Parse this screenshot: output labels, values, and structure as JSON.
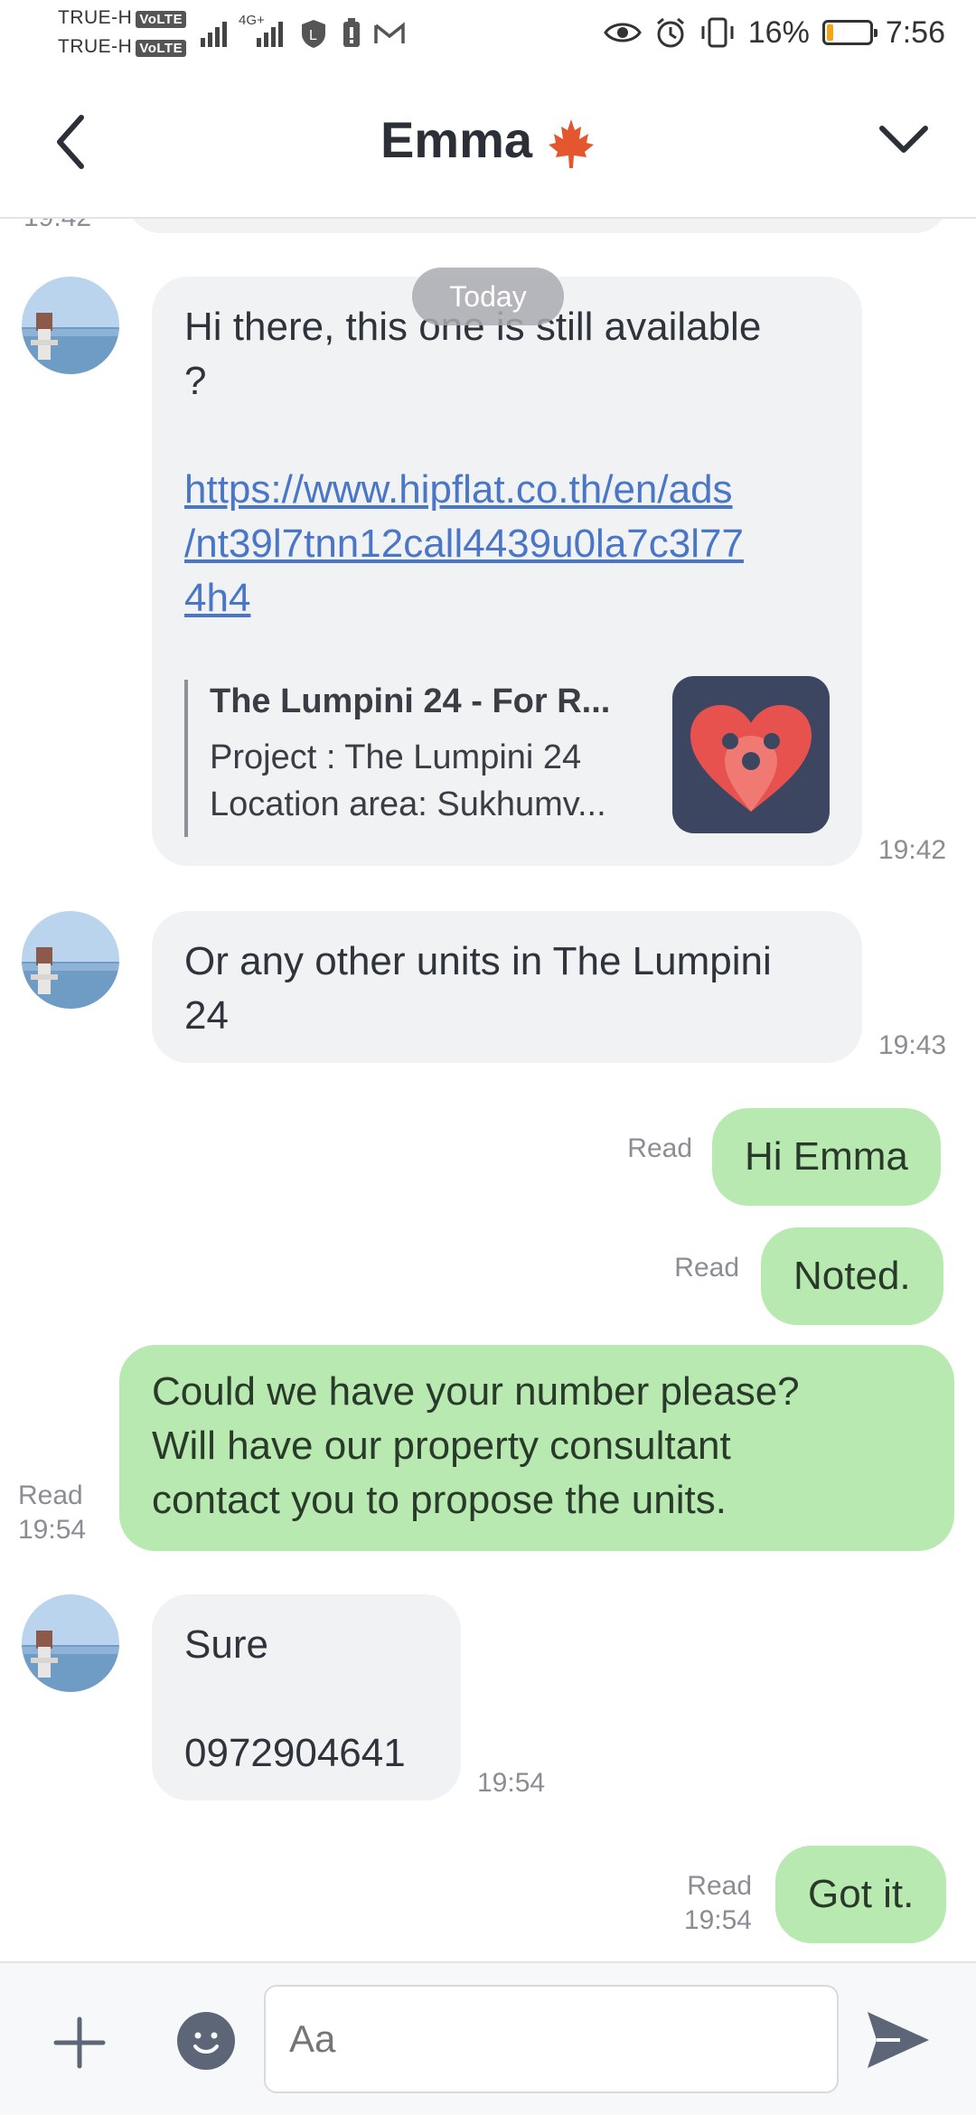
{
  "status_bar": {
    "carrier_1": "TRUE-H",
    "carrier_2": "TRUE-H",
    "volte": "VoLTE",
    "network": "4G+",
    "battery_percent": "16%",
    "battery_level": 0.16,
    "time": "7:56"
  },
  "header": {
    "title": "Emma",
    "title_emoji_icon": "maple-leaf-icon",
    "back_icon": "chevron-left-icon",
    "menu_icon": "chevron-down-icon"
  },
  "chat": {
    "previous_time": "19:42",
    "date_divider": "Today",
    "messages": [
      {
        "side": "in",
        "text_1": "Hi there, this one is still available",
        "text_2": "?",
        "link": "https://www.hipflat.co.th/en/ads/nt39l7tnn12call4439u0la7c3l774h4",
        "link_lines": [
          "https://www.hipflat.co.th/en/ads",
          "/nt39l7tnn12call4439u0la7c3l77",
          "4h4"
        ],
        "preview": {
          "title": "The Lumpini 24 - For R...",
          "line_1": "Project : The Lumpini 24",
          "line_2": "Location area: Sukhumv...",
          "icon": "hipflat-heart-pin-icon"
        },
        "time": "19:42"
      },
      {
        "side": "in",
        "lines": [
          "Or any other units in The Lumpini",
          "24"
        ],
        "time": "19:43"
      },
      {
        "side": "out",
        "text": "Hi Emma",
        "status": "Read"
      },
      {
        "side": "out",
        "text": "Noted.",
        "status": "Read"
      },
      {
        "side": "out",
        "lines": [
          "Could we have your number please?",
          "Will have our property consultant",
          "contact you to propose the units."
        ],
        "status": "Read",
        "time": "19:54"
      },
      {
        "side": "in",
        "lines": [
          "Sure",
          "",
          "0972904641"
        ],
        "time": "19:54"
      },
      {
        "side": "out",
        "text": "Got it.",
        "status": "Read",
        "time": "19:54"
      }
    ]
  },
  "composer": {
    "placeholder": "Aa",
    "plus_icon": "plus-icon",
    "emoji_icon": "emoji-icon",
    "send_icon": "send-icon"
  },
  "colors": {
    "incoming_bubble": "#f1f2f4",
    "outgoing_bubble": "#b8e9b1",
    "link": "#4a76c8",
    "battery_fill": "#f2a516",
    "maple_leaf": "#e4572e"
  }
}
